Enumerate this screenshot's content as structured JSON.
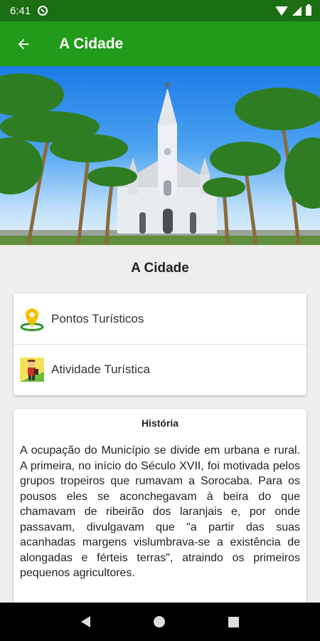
{
  "status_bar": {
    "time": "6:41"
  },
  "app_bar": {
    "title": "A Cidade"
  },
  "hero": {
    "alt": "Igreja matriz com palmeiras"
  },
  "page": {
    "heading": "A Cidade"
  },
  "menu": {
    "items": [
      {
        "label": "Pontos Turísticos",
        "icon": "map-pin-icon"
      },
      {
        "label": "Atividade Turística",
        "icon": "tourist-activity-icon"
      }
    ]
  },
  "history": {
    "title": "História",
    "text": "A ocupação do Município se divide em urbana e rural. A primeira, no início do Século XVII, foi motivada pelos grupos tropeiros que rumavam a Sorocaba. Para os pousos eles se aconchegavam à beira do que chamavam de ribeirão dos laranjais e, por onde passavam, divulgavam que \"a partir das suas acanhadas margens vislumbrava-se a existência de alongadas e férteis terras\", atraindo os primeiros pequenos agricultores."
  },
  "colors": {
    "status_bar": "#1b6e12",
    "app_bar": "#229a1a",
    "accent_yellow": "#f2c200"
  }
}
